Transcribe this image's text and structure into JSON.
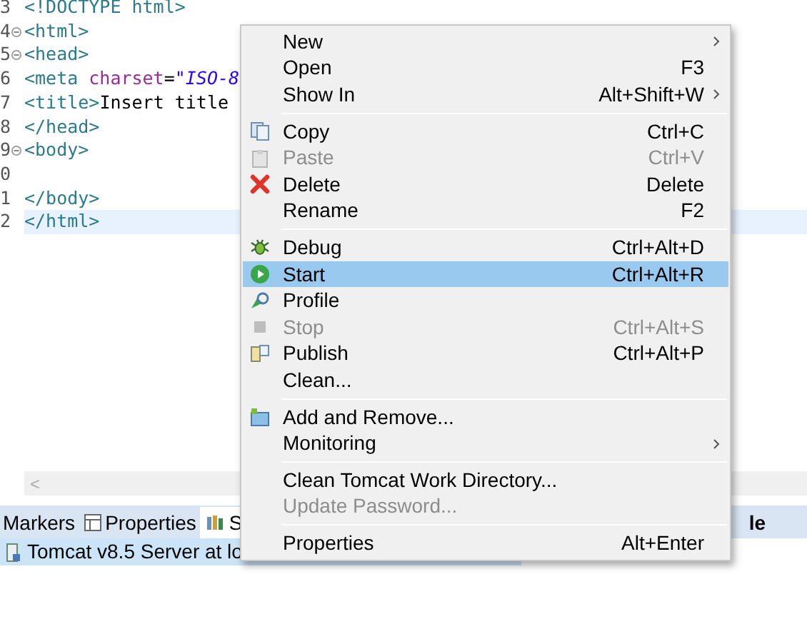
{
  "editor": {
    "lines": [
      {
        "number": "3",
        "foldable": false,
        "current": false,
        "tokens": [
          {
            "kind": "tag",
            "text": "<!DOCTYPE html>"
          }
        ]
      },
      {
        "number": "4",
        "foldable": true,
        "current": false,
        "tokens": [
          {
            "kind": "tag",
            "text": "<html>"
          }
        ]
      },
      {
        "number": "5",
        "foldable": true,
        "current": false,
        "tokens": [
          {
            "kind": "tag",
            "text": "<head>"
          }
        ]
      },
      {
        "number": "6",
        "foldable": false,
        "current": false,
        "tokens": [
          {
            "kind": "tag",
            "text": "<meta "
          },
          {
            "kind": "attr",
            "text": "charset"
          },
          {
            "kind": "plain",
            "text": "="
          },
          {
            "kind": "string",
            "text": "\"ISO-8"
          }
        ]
      },
      {
        "number": "7",
        "foldable": false,
        "current": false,
        "tokens": [
          {
            "kind": "tag",
            "text": "<title>"
          },
          {
            "kind": "plain",
            "text": "Insert title"
          }
        ]
      },
      {
        "number": "8",
        "foldable": false,
        "current": false,
        "tokens": [
          {
            "kind": "tag",
            "text": "</head>"
          }
        ]
      },
      {
        "number": "9",
        "foldable": true,
        "current": false,
        "tokens": [
          {
            "kind": "tag",
            "text": "<body>"
          }
        ]
      },
      {
        "number": "0",
        "foldable": false,
        "current": false
      },
      {
        "number": "1",
        "foldable": false,
        "current": false,
        "tokens": [
          {
            "kind": "tag",
            "text": "</body>"
          }
        ]
      },
      {
        "number": "2",
        "foldable": false,
        "current": true,
        "tokens": [
          {
            "kind": "tag",
            "text": "</html>"
          }
        ]
      }
    ],
    "scroll_left": "<"
  },
  "views": {
    "tabs": [
      {
        "label": "Markers",
        "selected": false
      },
      {
        "label": "Properties",
        "selected": false
      },
      {
        "label": "S",
        "selected": true
      },
      {
        "label": "le",
        "selected": false
      }
    ],
    "rows": [
      {
        "label": "Tomcat v8.5 Server at lo",
        "selected": true
      }
    ]
  },
  "context_menu": {
    "items": [
      {
        "kind": "item",
        "label": "New",
        "submenu": true,
        "disabled": false,
        "selected": false
      },
      {
        "kind": "item",
        "label": "Open",
        "shortcut": "F3",
        "submenu": false,
        "disabled": false,
        "selected": false
      },
      {
        "kind": "item",
        "label": "Show In",
        "shortcut": "Alt+Shift+W",
        "submenu": true,
        "disabled": false,
        "selected": false
      },
      {
        "kind": "separator"
      },
      {
        "kind": "item",
        "label": "Copy",
        "shortcut": "Ctrl+C",
        "submenu": false,
        "disabled": false,
        "selected": false
      },
      {
        "kind": "item",
        "label": "Paste",
        "shortcut": "Ctrl+V",
        "submenu": false,
        "disabled": true,
        "selected": false
      },
      {
        "kind": "item",
        "label": "Delete",
        "shortcut": "Delete",
        "submenu": false,
        "disabled": false,
        "selected": false
      },
      {
        "kind": "item",
        "label": "Rename",
        "shortcut": "F2",
        "submenu": false,
        "disabled": false,
        "selected": false
      },
      {
        "kind": "separator"
      },
      {
        "kind": "item",
        "label": "Debug",
        "shortcut": "Ctrl+Alt+D",
        "submenu": false,
        "disabled": false,
        "selected": false
      },
      {
        "kind": "item",
        "label": "Start",
        "shortcut": "Ctrl+Alt+R",
        "submenu": false,
        "disabled": false,
        "selected": true
      },
      {
        "kind": "item",
        "label": "Profile",
        "submenu": false,
        "disabled": false,
        "selected": false
      },
      {
        "kind": "item",
        "label": "Stop",
        "shortcut": "Ctrl+Alt+S",
        "submenu": false,
        "disabled": true,
        "selected": false
      },
      {
        "kind": "item",
        "label": "Publish",
        "shortcut": "Ctrl+Alt+P",
        "submenu": false,
        "disabled": false,
        "selected": false
      },
      {
        "kind": "item",
        "label": "Clean...",
        "submenu": false,
        "disabled": false,
        "selected": false
      },
      {
        "kind": "separator"
      },
      {
        "kind": "item",
        "label": "Add and Remove...",
        "submenu": false,
        "disabled": false,
        "selected": false
      },
      {
        "kind": "item",
        "label": "Monitoring",
        "submenu": true,
        "disabled": false,
        "selected": false
      },
      {
        "kind": "separator"
      },
      {
        "kind": "item",
        "label": "Clean Tomcat Work Directory...",
        "submenu": false,
        "disabled": false,
        "selected": false
      },
      {
        "kind": "item",
        "label": "Update Password...",
        "submenu": false,
        "disabled": true,
        "selected": false
      },
      {
        "kind": "separator"
      },
      {
        "kind": "item",
        "label": "Properties",
        "shortcut": "Alt+Enter",
        "submenu": false,
        "disabled": false,
        "selected": false
      }
    ]
  }
}
